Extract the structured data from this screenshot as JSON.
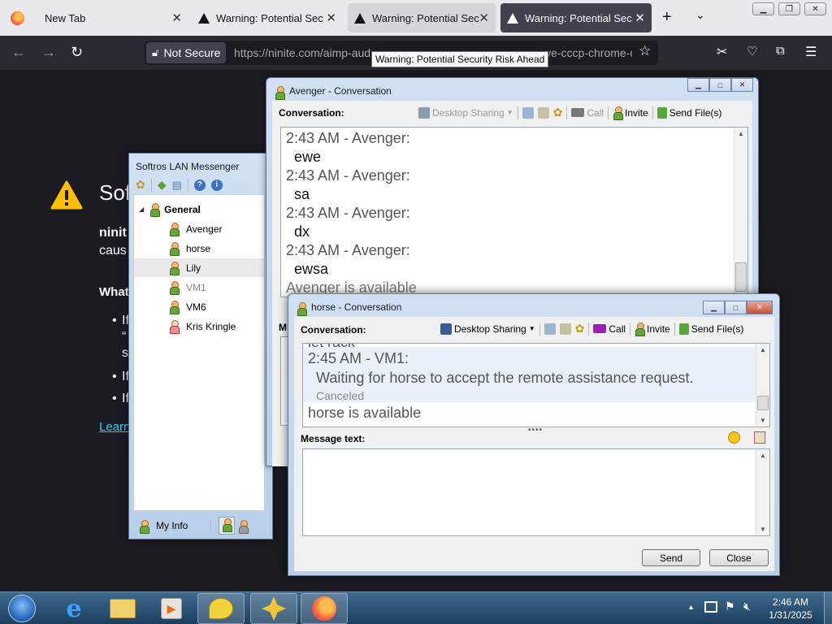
{
  "browser": {
    "tabs": [
      {
        "label": "New Tab"
      },
      {
        "label": "Warning: Potential Secur"
      },
      {
        "label": "Warning: Potential Secur"
      },
      {
        "label": "Warning: Potential Secur"
      }
    ],
    "security_label": "Not Secure",
    "url": "https://ninite.com/aimp-aud",
    "url_tail": "ve-cccp-chrome-c",
    "tooltip": "Warning: Potential Security Risk Ahead"
  },
  "page": {
    "title_partial": "Sof",
    "line1": "ninit",
    "line2": "caus",
    "heading": "What",
    "b1": "If",
    "b1b": "“",
    "b1c": "s",
    "b2": "If",
    "b3": "If",
    "learn": "Learn"
  },
  "lan": {
    "title": "Softros LAN Messenger",
    "group": "General",
    "users": [
      {
        "name": "Avenger"
      },
      {
        "name": "horse"
      },
      {
        "name": "Lily"
      },
      {
        "name": "VM1"
      },
      {
        "name": "VM6"
      },
      {
        "name": "Kris Kringle"
      }
    ],
    "myinfo": "My Info"
  },
  "avenger": {
    "title": "Avenger - Conversation",
    "conv_label": "Conversation:",
    "desktop_sharing": "Desktop Sharing",
    "call": "Call",
    "invite": "Invite",
    "send_files": "Send File(s)",
    "msg_label_partial": "M",
    "messages": [
      {
        "head": "2:43 AM - Avenger:",
        "text": "ewe"
      },
      {
        "head": "2:43 AM - Avenger:",
        "text": "sa"
      },
      {
        "head": "2:43 AM - Avenger:",
        "text": "dx"
      },
      {
        "head": "2:43 AM - Avenger:",
        "text": "ewsa"
      }
    ],
    "status": "Avenger is available"
  },
  "horse": {
    "title": "horse - Conversation",
    "conv_label": "Conversation:",
    "desktop_sharing": "Desktop Sharing",
    "call": "Call",
    "invite": "Invite",
    "send_files": "Send File(s)",
    "cut_line": "let rack",
    "head": "2:45 AM - VM1:",
    "request": "Waiting for horse to accept the remote assistance request.",
    "canceled": "Canceled",
    "status": "horse is available",
    "message_label": "Message text:",
    "send": "Send",
    "close": "Close"
  },
  "taskbar": {
    "time": "2:46 AM",
    "date": "1/31/2025"
  }
}
